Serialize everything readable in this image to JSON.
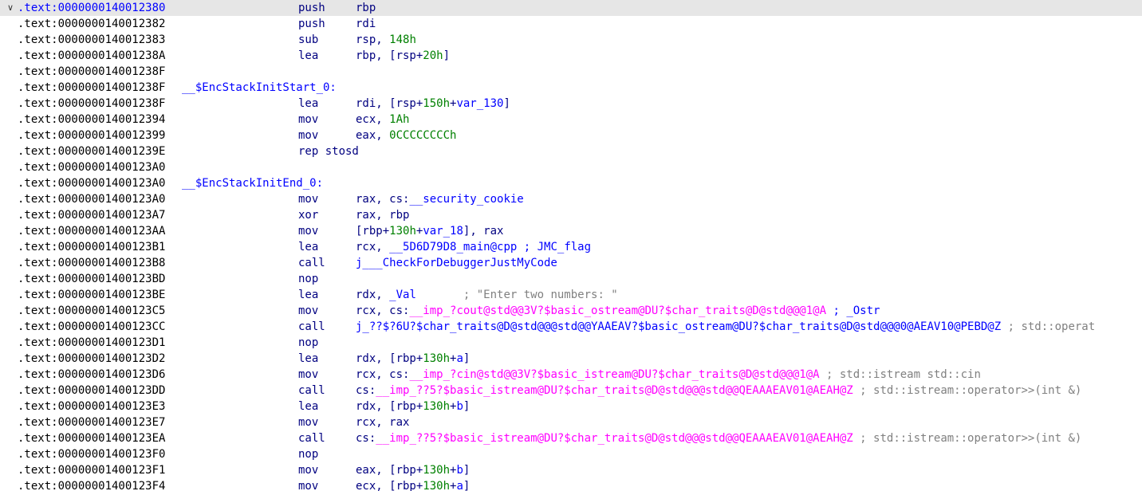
{
  "disassembly": {
    "lines": [
      {
        "addr": ".text:0000000140012380",
        "label": "",
        "mnemonic": "push",
        "operands": [
          {
            "t": "rbp",
            "c": "reg"
          }
        ],
        "selected": true
      },
      {
        "addr": ".text:0000000140012382",
        "label": "",
        "mnemonic": "push",
        "operands": [
          {
            "t": "rdi",
            "c": "reg"
          }
        ]
      },
      {
        "addr": ".text:0000000140012383",
        "label": "",
        "mnemonic": "sub",
        "operands": [
          {
            "t": "rsp, ",
            "c": "reg"
          },
          {
            "t": "148h",
            "c": "num"
          }
        ]
      },
      {
        "addr": ".text:000000014001238A",
        "label": "",
        "mnemonic": "lea",
        "operands": [
          {
            "t": "rbp, [rsp+",
            "c": "reg"
          },
          {
            "t": "20h",
            "c": "num"
          },
          {
            "t": "]",
            "c": "reg"
          }
        ]
      },
      {
        "addr": ".text:000000014001238F",
        "label": "",
        "mnemonic": "",
        "operands": []
      },
      {
        "addr": ".text:000000014001238F",
        "label": "__$EncStackInitStart_0:",
        "mnemonic": "",
        "operands": []
      },
      {
        "addr": ".text:000000014001238F",
        "label": "",
        "mnemonic": "lea",
        "operands": [
          {
            "t": "rdi, [rsp+",
            "c": "reg"
          },
          {
            "t": "150h",
            "c": "num"
          },
          {
            "t": "+",
            "c": "reg"
          },
          {
            "t": "var_130",
            "c": "sym"
          },
          {
            "t": "]",
            "c": "reg"
          }
        ]
      },
      {
        "addr": ".text:0000000140012394",
        "label": "",
        "mnemonic": "mov",
        "operands": [
          {
            "t": "ecx, ",
            "c": "reg"
          },
          {
            "t": "1Ah",
            "c": "num"
          }
        ]
      },
      {
        "addr": ".text:0000000140012399",
        "label": "",
        "mnemonic": "mov",
        "operands": [
          {
            "t": "eax, ",
            "c": "reg"
          },
          {
            "t": "0CCCCCCCCh",
            "c": "num"
          }
        ]
      },
      {
        "addr": ".text:000000014001239E",
        "label": "",
        "mnemonic": "rep stosd",
        "operands": []
      },
      {
        "addr": ".text:00000001400123A0",
        "label": "",
        "mnemonic": "",
        "operands": []
      },
      {
        "addr": ".text:00000001400123A0",
        "label": "__$EncStackInitEnd_0:",
        "mnemonic": "",
        "operands": []
      },
      {
        "addr": ".text:00000001400123A0",
        "label": "",
        "mnemonic": "mov",
        "operands": [
          {
            "t": "rax, cs:",
            "c": "reg"
          },
          {
            "t": "__security_cookie",
            "c": "sym"
          }
        ]
      },
      {
        "addr": ".text:00000001400123A7",
        "label": "",
        "mnemonic": "xor",
        "operands": [
          {
            "t": "rax, rbp",
            "c": "reg"
          }
        ]
      },
      {
        "addr": ".text:00000001400123AA",
        "label": "",
        "mnemonic": "mov",
        "operands": [
          {
            "t": "[rbp+",
            "c": "reg"
          },
          {
            "t": "130h",
            "c": "num"
          },
          {
            "t": "+",
            "c": "reg"
          },
          {
            "t": "var_18",
            "c": "sym"
          },
          {
            "t": "], rax",
            "c": "reg"
          }
        ]
      },
      {
        "addr": ".text:00000001400123B1",
        "label": "",
        "mnemonic": "lea",
        "operands": [
          {
            "t": "rcx, ",
            "c": "reg"
          },
          {
            "t": "__5D6D79D8_main@cpp",
            "c": "sym"
          },
          {
            "t": " ; JMC_flag",
            "c": "sym"
          }
        ]
      },
      {
        "addr": ".text:00000001400123B8",
        "label": "",
        "mnemonic": "call",
        "operands": [
          {
            "t": "j___CheckForDebuggerJustMyCode",
            "c": "sym"
          }
        ]
      },
      {
        "addr": ".text:00000001400123BD",
        "label": "",
        "mnemonic": "nop",
        "operands": []
      },
      {
        "addr": ".text:00000001400123BE",
        "label": "",
        "mnemonic": "lea",
        "operands": [
          {
            "t": "rdx, ",
            "c": "reg"
          },
          {
            "t": "_Val",
            "c": "sym"
          },
          {
            "t": "       ; \"Enter two numbers: \"",
            "c": "cmt"
          }
        ]
      },
      {
        "addr": ".text:00000001400123C5",
        "label": "",
        "mnemonic": "mov",
        "operands": [
          {
            "t": "rcx, cs:",
            "c": "reg"
          },
          {
            "t": "__imp_?cout@std@@3V?$basic_ostream@DU?$char_traits@D@std@@@1@A",
            "c": "imp"
          },
          {
            "t": " ; _Ostr",
            "c": "sym"
          }
        ]
      },
      {
        "addr": ".text:00000001400123CC",
        "label": "",
        "mnemonic": "call",
        "operands": [
          {
            "t": "j_??$?6U?$char_traits@D@std@@@std@@YAAEAV?$basic_ostream@DU?$char_traits@D@std@@@0@AEAV10@PEBD@Z",
            "c": "sym"
          },
          {
            "t": " ; std::operat",
            "c": "cmt"
          }
        ]
      },
      {
        "addr": ".text:00000001400123D1",
        "label": "",
        "mnemonic": "nop",
        "operands": []
      },
      {
        "addr": ".text:00000001400123D2",
        "label": "",
        "mnemonic": "lea",
        "operands": [
          {
            "t": "rdx, [rbp+",
            "c": "reg"
          },
          {
            "t": "130h",
            "c": "num"
          },
          {
            "t": "+",
            "c": "reg"
          },
          {
            "t": "a",
            "c": "sym"
          },
          {
            "t": "]",
            "c": "reg"
          }
        ]
      },
      {
        "addr": ".text:00000001400123D6",
        "label": "",
        "mnemonic": "mov",
        "operands": [
          {
            "t": "rcx, cs:",
            "c": "reg"
          },
          {
            "t": "__imp_?cin@std@@3V?$basic_istream@DU?$char_traits@D@std@@@1@A",
            "c": "imp"
          },
          {
            "t": " ; std::istream std::cin",
            "c": "cmt"
          }
        ]
      },
      {
        "addr": ".text:00000001400123DD",
        "label": "",
        "mnemonic": "call",
        "operands": [
          {
            "t": "cs:",
            "c": "reg"
          },
          {
            "t": "__imp_??5?$basic_istream@DU?$char_traits@D@std@@@std@@QEAAAEAV01@AEAH@Z",
            "c": "imp"
          },
          {
            "t": " ; std::istream::operator>>(int &)",
            "c": "cmt"
          }
        ]
      },
      {
        "addr": ".text:00000001400123E3",
        "label": "",
        "mnemonic": "lea",
        "operands": [
          {
            "t": "rdx, [rbp+",
            "c": "reg"
          },
          {
            "t": "130h",
            "c": "num"
          },
          {
            "t": "+",
            "c": "reg"
          },
          {
            "t": "b",
            "c": "sym"
          },
          {
            "t": "]",
            "c": "reg"
          }
        ]
      },
      {
        "addr": ".text:00000001400123E7",
        "label": "",
        "mnemonic": "mov",
        "operands": [
          {
            "t": "rcx, rax",
            "c": "reg"
          }
        ]
      },
      {
        "addr": ".text:00000001400123EA",
        "label": "",
        "mnemonic": "call",
        "operands": [
          {
            "t": "cs:",
            "c": "reg"
          },
          {
            "t": "__imp_??5?$basic_istream@DU?$char_traits@D@std@@@std@@QEAAAEAV01@AEAH@Z",
            "c": "imp"
          },
          {
            "t": " ; std::istream::operator>>(int &)",
            "c": "cmt"
          }
        ]
      },
      {
        "addr": ".text:00000001400123F0",
        "label": "",
        "mnemonic": "nop",
        "operands": []
      },
      {
        "addr": ".text:00000001400123F1",
        "label": "",
        "mnemonic": "mov",
        "operands": [
          {
            "t": "eax, [rbp+",
            "c": "reg"
          },
          {
            "t": "130h",
            "c": "num"
          },
          {
            "t": "+",
            "c": "reg"
          },
          {
            "t": "b",
            "c": "sym"
          },
          {
            "t": "]",
            "c": "reg"
          }
        ]
      },
      {
        "addr": ".text:00000001400123F4",
        "label": "",
        "mnemonic": "mov",
        "operands": [
          {
            "t": "ecx, [rbp+",
            "c": "reg"
          },
          {
            "t": "130h",
            "c": "num"
          },
          {
            "t": "+",
            "c": "reg"
          },
          {
            "t": "a",
            "c": "sym"
          },
          {
            "t": "]",
            "c": "reg"
          }
        ]
      }
    ]
  }
}
